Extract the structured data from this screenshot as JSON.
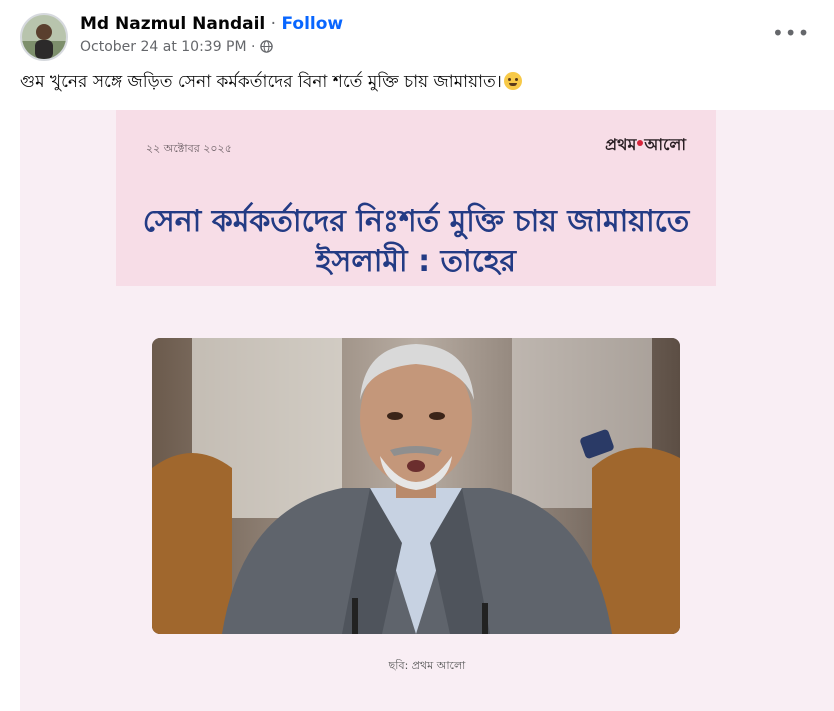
{
  "post": {
    "author": "Md Nazmul Nandail",
    "separator": "·",
    "follow_label": "Follow",
    "timestamp": "October 24 at 10:39 PM",
    "meta_separator": "·",
    "audience_icon": "globe-icon",
    "more_icon": "more-options-icon",
    "more_label": "•••",
    "caption": "গুম খুনের সঙ্গে জড়িত সেনা কর্মকর্তাদের বিনা শর্তে মুক্তি চায় জামায়াত।",
    "caption_emoji": "thinking-face-emoji"
  },
  "news_card": {
    "date": "২২ অক্টোবর ২০২৫",
    "logo_text_a": "প্রথম",
    "logo_text_b": "আলো",
    "headline_line1": "সেনা কর্মকর্তাদের নিঃশর্ত মুক্তি চায় জামায়াতে",
    "headline_line2": "ইসলামী : তাহের",
    "photo_credit": "ছবি: প্রথম আলো"
  },
  "colors": {
    "follow": "#0866ff",
    "meta": "#65676b",
    "headline": "#233b84",
    "banner_bg": "#f7dde7",
    "frame_bg": "#f9eef4"
  }
}
